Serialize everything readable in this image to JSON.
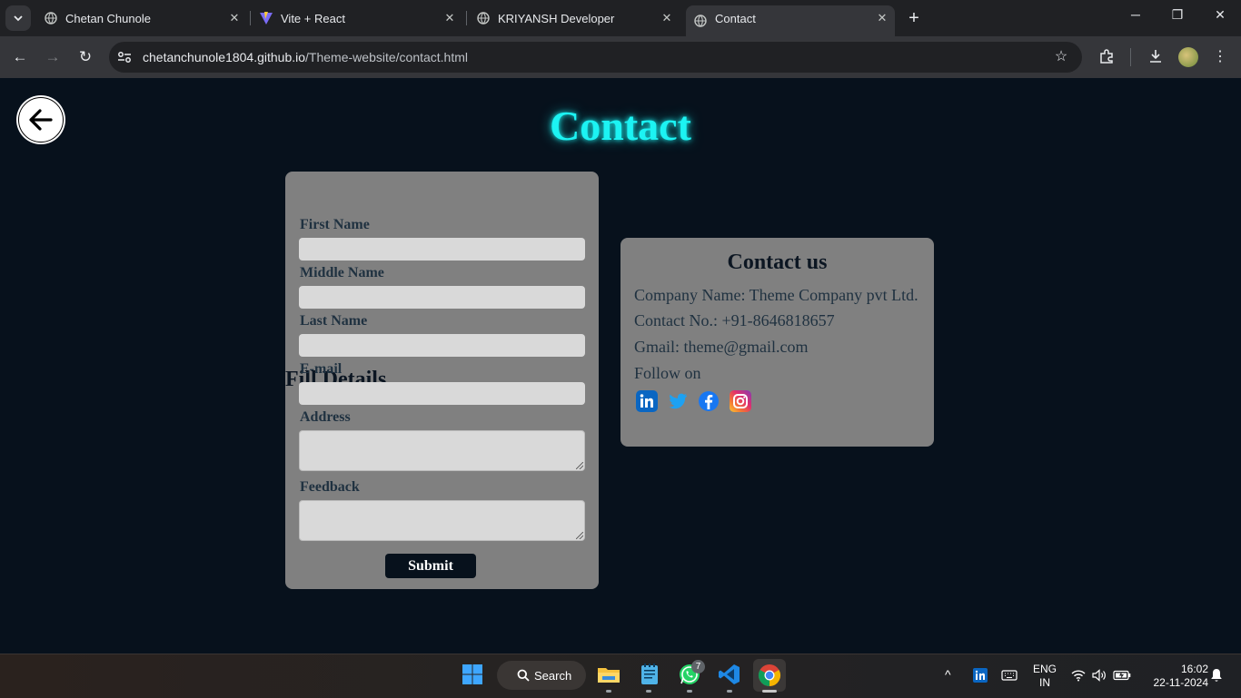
{
  "browser": {
    "tabs": [
      {
        "title": "Chetan Chunole",
        "active": false
      },
      {
        "title": "Vite + React",
        "active": false
      },
      {
        "title": "KRIYANSH Developer",
        "active": false
      },
      {
        "title": "Contact",
        "active": true
      }
    ],
    "url_domain": "chetanchunole1804.github.io",
    "url_path": "/Theme-website/contact.html"
  },
  "page": {
    "title": "Contact",
    "form": {
      "heading": "Fill Details",
      "fields": [
        {
          "label": "First Name",
          "value": "",
          "type": "input"
        },
        {
          "label": "Middle Name",
          "value": "",
          "type": "input"
        },
        {
          "label": "Last Name",
          "value": "",
          "type": "input"
        },
        {
          "label": "E-mail",
          "value": "",
          "type": "input"
        },
        {
          "label": "Address",
          "value": "",
          "type": "textarea"
        },
        {
          "label": "Feedback",
          "value": "",
          "type": "textarea"
        }
      ],
      "submit_label": "Submit"
    },
    "contact": {
      "heading": "Contact us",
      "company": "Company Name: Theme Company pvt Ltd.",
      "phone": "Contact No.: +91-8646818657",
      "email": "Gmail: theme@gmail.com",
      "follow": "Follow on",
      "social_icons": [
        "linkedin-icon",
        "twitter-icon",
        "facebook-icon",
        "instagram-icon"
      ]
    }
  },
  "taskbar": {
    "search_label": "Search",
    "whatsapp_badge": "7",
    "language_line1": "ENG",
    "language_line2": "IN",
    "time": "16:02",
    "date": "22-11-2024"
  },
  "colors": {
    "page_bg": "#07111c",
    "title_cyan": "#1cf3f3",
    "card_gray": "#808080",
    "input_gray": "#d9d9d9"
  }
}
